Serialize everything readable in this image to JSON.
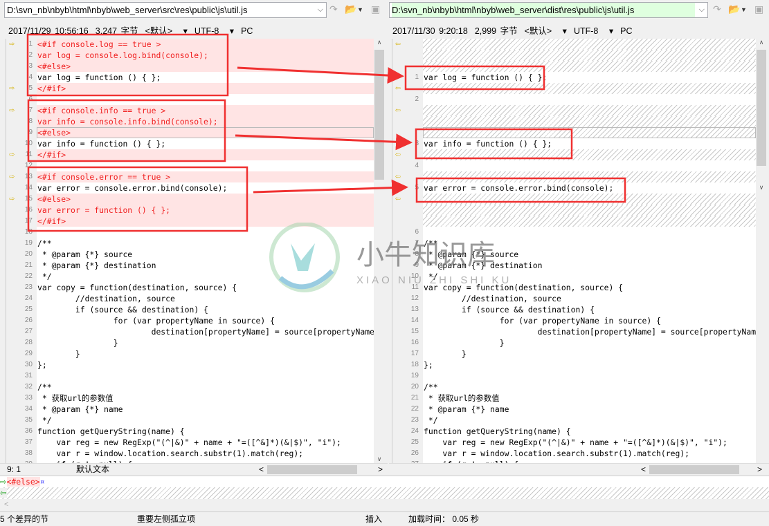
{
  "left": {
    "path": "D:\\svn_nb\\nbyb\\html\\nbyb\\web_server\\src\\res\\public\\js\\util.js",
    "date": "2017/11/29 10:56:16",
    "size": "3,247 字节",
    "format": "<默认>",
    "encoding": "UTF-8",
    "lineend": "PC",
    "cursor": "9: 1",
    "syntax": "默认文本",
    "lines": [
      {
        "n": "1",
        "t": "<#if console.log == true >",
        "d": 1,
        "a": 1
      },
      {
        "n": "2",
        "t": "var log = console.log.bind(console);",
        "d": 1
      },
      {
        "n": "3",
        "t": "<#else>",
        "d": 1
      },
      {
        "n": "4",
        "t": "var log = function () { };"
      },
      {
        "n": "5",
        "t": "</#if>",
        "d": 1,
        "a": 1
      },
      {
        "n": "6",
        "t": ""
      },
      {
        "n": "7",
        "t": "<#if console.info == true >",
        "d": 1,
        "a": 1
      },
      {
        "n": "8",
        "t": "var info = console.info.bind(console);",
        "d": 1
      },
      {
        "n": "9",
        "t": "<#else>",
        "d": 1,
        "c": 1
      },
      {
        "n": "10",
        "t": "var info = function () { };"
      },
      {
        "n": "11",
        "t": "</#if>",
        "d": 1,
        "a": 1
      },
      {
        "n": "12",
        "t": ""
      },
      {
        "n": "13",
        "t": "<#if console.error == true >",
        "d": 1,
        "a": 1
      },
      {
        "n": "14",
        "t": "var error = console.error.bind(console);"
      },
      {
        "n": "15",
        "t": "<#else>",
        "d": 1,
        "a": 1
      },
      {
        "n": "16",
        "t": "var error = function () { };",
        "d": 1
      },
      {
        "n": "17",
        "t": "</#if>",
        "d": 1
      },
      {
        "n": "18",
        "t": ""
      },
      {
        "n": "19",
        "t": "/**"
      },
      {
        "n": "20",
        "t": " * @param {*} source"
      },
      {
        "n": "21",
        "t": " * @param {*} destination"
      },
      {
        "n": "22",
        "t": " */"
      },
      {
        "n": "23",
        "t": "var copy = function(destination, source) {"
      },
      {
        "n": "24",
        "t": "\t//destination, source"
      },
      {
        "n": "25",
        "t": "\tif (source && destination) {"
      },
      {
        "n": "26",
        "t": "\t\tfor (var propertyName in source) {"
      },
      {
        "n": "27",
        "t": "\t\t\tdestination[propertyName] = source[propertyName];"
      },
      {
        "n": "28",
        "t": "\t\t}"
      },
      {
        "n": "29",
        "t": "\t}"
      },
      {
        "n": "30",
        "t": "};"
      },
      {
        "n": "31",
        "t": ""
      },
      {
        "n": "32",
        "t": "/**"
      },
      {
        "n": "33",
        "t": " * 获取url的参数值"
      },
      {
        "n": "34",
        "t": " * @param {*} name"
      },
      {
        "n": "35",
        "t": " */"
      },
      {
        "n": "36",
        "t": "function getQueryString(name) {"
      },
      {
        "n": "37",
        "t": "    var reg = new RegExp(\"(^|&)\" + name + \"=([^&]*)(&|$)\", \"i\");"
      },
      {
        "n": "38",
        "t": "    var r = window.location.search.substr(1).match(reg);"
      },
      {
        "n": "39",
        "t": "    if (r != null) {"
      }
    ]
  },
  "right": {
    "path": "D:\\svn_nb\\nbyb\\html\\nbyb\\web_server\\dist\\res\\public\\js\\util.js",
    "date": "2017/11/30 9:20:18",
    "size": "2,999 字节",
    "format": "<默认>",
    "encoding": "UTF-8",
    "lineend": "PC",
    "lines": [
      {
        "h": 1,
        "a": 1
      },
      {
        "h": 1
      },
      {
        "h": 1
      },
      {
        "n": "1",
        "t": "var log = function () { };"
      },
      {
        "h": 1,
        "a": 1
      },
      {
        "n": "2",
        "t": ""
      },
      {
        "h": 1,
        "a": 1
      },
      {
        "h": 1
      },
      {
        "h": 1,
        "c": 1
      },
      {
        "n": "3",
        "t": "var info = function () { };"
      },
      {
        "h": 1,
        "a": 1
      },
      {
        "n": "4",
        "t": ""
      },
      {
        "h": 1,
        "a": 1
      },
      {
        "n": "5",
        "t": "var error = console.error.bind(console);"
      },
      {
        "h": 1,
        "a": 1
      },
      {
        "h": 1
      },
      {
        "h": 1
      },
      {
        "n": "6",
        "t": ""
      },
      {
        "n": "7",
        "t": "/**"
      },
      {
        "n": "8",
        "t": " * @param {*} source"
      },
      {
        "n": "9",
        "t": " * @param {*} destination"
      },
      {
        "n": "10",
        "t": " */"
      },
      {
        "n": "11",
        "t": "var copy = function(destination, source) {"
      },
      {
        "n": "12",
        "t": "\t//destination, source"
      },
      {
        "n": "13",
        "t": "\tif (source && destination) {"
      },
      {
        "n": "14",
        "t": "\t\tfor (var propertyName in source) {"
      },
      {
        "n": "15",
        "t": "\t\t\tdestination[propertyName] = source[propertyName];"
      },
      {
        "n": "16",
        "t": "\t\t}"
      },
      {
        "n": "17",
        "t": "\t}"
      },
      {
        "n": "18",
        "t": "};"
      },
      {
        "n": "19",
        "t": ""
      },
      {
        "n": "20",
        "t": "/**"
      },
      {
        "n": "21",
        "t": " * 获取url的参数值"
      },
      {
        "n": "22",
        "t": " * @param {*} name"
      },
      {
        "n": "23",
        "t": " */"
      },
      {
        "n": "24",
        "t": "function getQueryString(name) {"
      },
      {
        "n": "25",
        "t": "    var reg = new RegExp(\"(^|&)\" + name + \"=([^&]*)(&|$)\", \"i\");"
      },
      {
        "n": "26",
        "t": "    var r = window.location.search.substr(1).match(reg);"
      },
      {
        "n": "27",
        "t": "    if (r != null) {"
      }
    ]
  },
  "detail": {
    "left_line": "<#else>",
    "eol_mark": "¤"
  },
  "status": {
    "diffs": "5 个差异的节",
    "mode": "重要左侧孤立项",
    "insert": "插入",
    "load_time": "加载时间： 0.05 秒"
  },
  "watermark": {
    "cn": "小牛知识库",
    "en": "XIAO NIU ZHI SHI KU"
  },
  "colors": {
    "diff_bg": "#ffe4e4",
    "diff_text": "#f02020",
    "annotation": "#f03030",
    "match_path_bg": "#dfffdf"
  },
  "icons": {
    "next": "next-diff-icon",
    "open": "folder-open-icon",
    "save": "save-icon",
    "diff_arrow": "arrow-right-icon",
    "copy_arrow": "arrow-left-icon"
  }
}
